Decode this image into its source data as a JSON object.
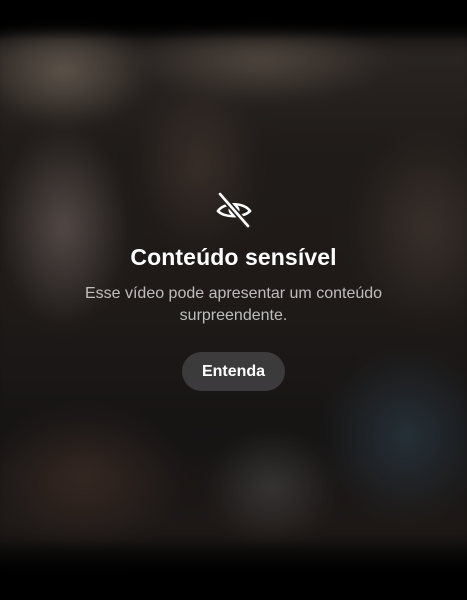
{
  "warning": {
    "icon": "eye-slash-icon",
    "title": "Conteúdo sensível",
    "description": "Esse vídeo pode apresentar um conteúdo surpreendente.",
    "button_label": "Entenda"
  }
}
